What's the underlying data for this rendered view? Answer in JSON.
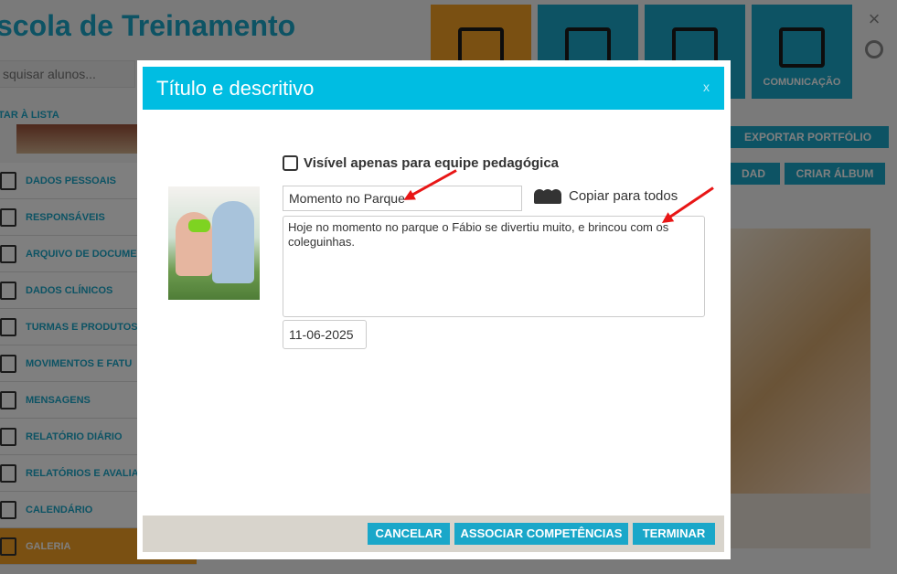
{
  "header": {
    "title": "scola de Treinamento",
    "search_placeholder": "squisar alunos...",
    "back_label": "TAR À LISTA"
  },
  "top_buttons": [
    {
      "label": ""
    },
    {
      "label": ""
    },
    {
      "label": ""
    },
    {
      "label": "COMUNICAÇÃO"
    }
  ],
  "sidebar": {
    "items": [
      {
        "label": "DADOS PESSOAIS"
      },
      {
        "label": "RESPONSÁVEIS"
      },
      {
        "label": "ARQUIVO DE DOCUME"
      },
      {
        "label": "DADOS CLÍNICOS"
      },
      {
        "label": "TURMAS E PRODUTOS"
      },
      {
        "label": "MOVIMENTOS E FATU"
      },
      {
        "label": "MENSAGENS"
      },
      {
        "label": "RELATÓRIO DIÁRIO"
      },
      {
        "label": "RELATÓRIOS E AVALIA"
      },
      {
        "label": "CALENDÁRIO"
      },
      {
        "label": "GALERIA"
      }
    ]
  },
  "right_panel": {
    "export_label": "EXPORTAR PORTFÓLIO",
    "dad_label": "DAD",
    "album_label": "CRIAR ÁLBUM"
  },
  "modal": {
    "title": "Título e descritivo",
    "close": "x",
    "visible_label": "Visível apenas para equipe pedagógica",
    "title_value": "Momento no Parque",
    "copy_label": "Copiar para todos",
    "description": "Hoje no momento no parque o Fábio se divertiu muito, e brincou com os coleguinhas.",
    "date": "11-06-2025",
    "buttons": {
      "cancel": "CANCELAR",
      "assoc": "ASSOCIAR COMPETÊNCIAS",
      "finish": "TERMINAR"
    }
  },
  "colors": {
    "accent": "#1aa7c9",
    "header": "#00bde2",
    "orange": "#f4a024",
    "arrow": "#e81616"
  }
}
